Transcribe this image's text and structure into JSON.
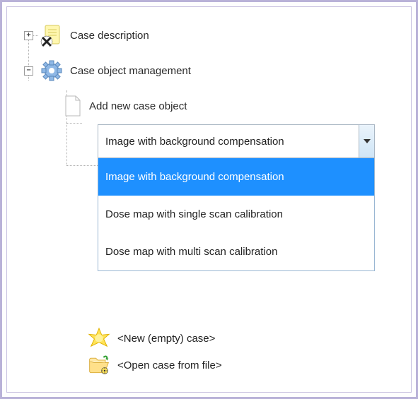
{
  "tree": {
    "case_description": {
      "label": "Case description",
      "expander": "+"
    },
    "case_obj_mgmt": {
      "label": "Case object management",
      "expander": "−"
    },
    "add_obj": {
      "label": "Add new case object"
    }
  },
  "dropdown": {
    "selected": "Image with background compensation",
    "options": [
      "Image with background compensation",
      "Dose map with single scan calibration",
      "Dose map with multi scan calibration"
    ]
  },
  "footer": {
    "new_case": "<New (empty) case>",
    "open_case": "<Open case from file>"
  }
}
